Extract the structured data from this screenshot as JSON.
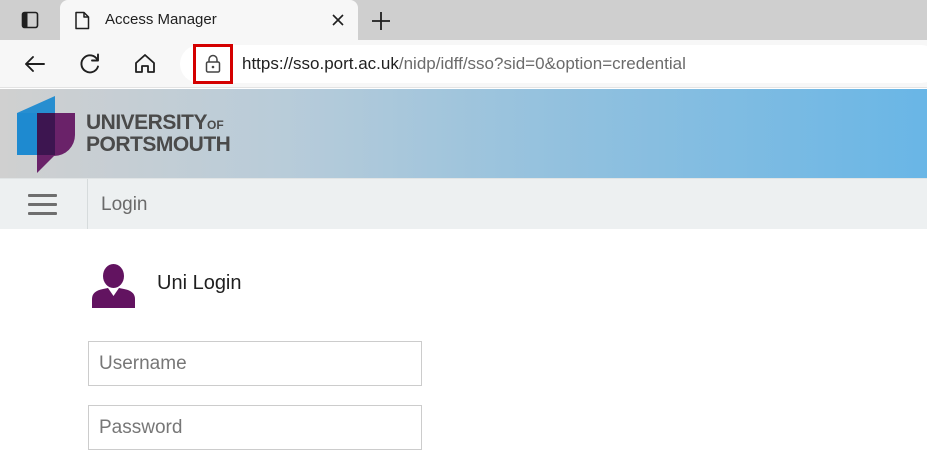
{
  "browser": {
    "tab_title": "Access Manager",
    "url_host": "https://sso.port.ac.uk",
    "url_path": "/nidp/idff/sso?sid=0&option=credential",
    "icons": {
      "tab_actions": "tab-actions-icon",
      "page": "document-icon",
      "close": "close-icon",
      "new_tab": "plus-icon",
      "back": "back-arrow-icon",
      "reload": "reload-icon",
      "home": "home-icon",
      "lock": "lock-icon"
    },
    "highlight_color": "#d40000"
  },
  "site": {
    "logo_line1": "UNIVERSITY",
    "logo_of": "OF",
    "logo_line2": "PORTSMOUTH",
    "colors": {
      "brand_purple": "#621360",
      "brand_blue": "#1e8ad0",
      "header_blue": "#69b6e6"
    }
  },
  "nav": {
    "menu_icon": "hamburger-menu-icon",
    "title": "Login"
  },
  "login": {
    "heading": "Uni Login",
    "user_icon": "user-icon",
    "username_placeholder": "Username",
    "password_placeholder": "Password"
  }
}
